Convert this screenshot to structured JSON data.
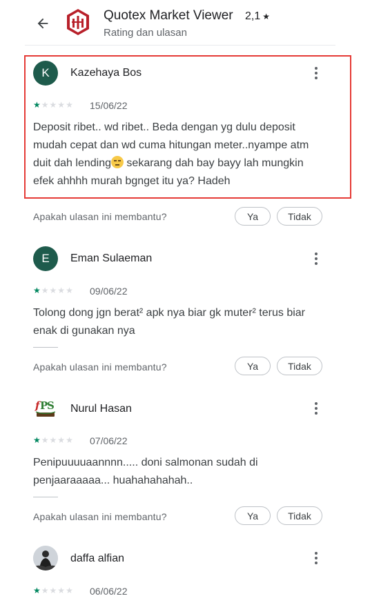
{
  "header": {
    "app_name": "Quotex Market Viewer",
    "app_rating": "2,1",
    "subtitle": "Rating dan ulasan"
  },
  "icons": {
    "back": "arrow-back-icon",
    "app": "quotex-app-icon",
    "more": "more-vert-icon",
    "star": "star-icon"
  },
  "colors": {
    "highlight": "#e53935",
    "star_filled": "#01875f",
    "star_empty": "#dadce0",
    "avatar_green": "#1e5b4c"
  },
  "helpful_prompt": "Apakah ulasan ini membantu?",
  "yes_label": "Ya",
  "no_label": "Tidak",
  "reviews": [
    {
      "initial": "K",
      "author": "Kazehaya Bos",
      "rating": 1,
      "date": "15/06/22",
      "text_before_emoji": "Deposit ribet.. wd ribet.. Beda dengan yg dulu deposit mudah cepat dan wd cuma hitungan meter..nyampe atm duit dah lending",
      "text_after_emoji": " sekarang dah bay bayy lah mungkin efek ahhhh murah bgnget itu ya? Hadeh"
    },
    {
      "initial": "E",
      "author": "Eman Sulaeman",
      "rating": 1,
      "date": "09/06/22",
      "text": "Tolong dong jgn berat² apk nya biar gk muter² terus biar enak di gunakan nya"
    },
    {
      "author": "Nurul Hasan",
      "avatar_text": "FPS",
      "rating": 1,
      "date": "07/06/22",
      "text": "Penipuuuuaannnn..... doni salmonan sudah di penjaaraaaaa... huahahahahah.."
    },
    {
      "author": "daffa alfian",
      "rating": 1,
      "date": "06/06/22"
    }
  ]
}
